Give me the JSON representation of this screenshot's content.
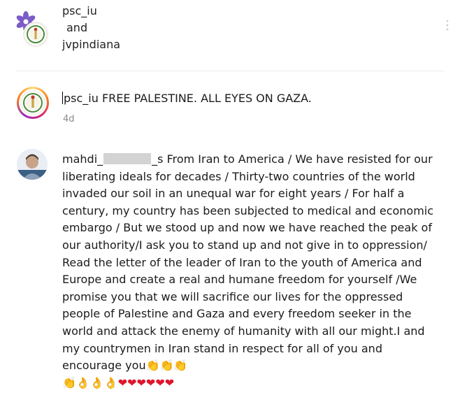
{
  "post_header": {
    "author_primary": "psc_iu",
    "conjunction": "and",
    "author_secondary": "jvpindiana"
  },
  "caption": {
    "username": "psc_iu",
    "text": "FREE PALESTINE. ALL EYES ON GAZA.",
    "time_ago": "4d"
  },
  "comment": {
    "username_start": "mahdi_",
    "username_end": "_s",
    "text": "From Iran to America / We have resisted for our liberating ideals for decades / Thirty-two countries of the world invaded our soil in an unequal war for eight years / For half a century, my country has been subjected to medical and economic embargo / But we stood up and now we have reached the peak of our authority/I ask you to stand up and not give in to oppression/ Read the letter of the leader of Iran to the youth of America and Europe and create a real and humane freedom for yourself /We promise you that we will sacrifice our lives for the oppressed people of Palestine and Gaza and every freedom seeker in the world and attack the enemy of humanity with all our might.I and my countrymen in Iran stand in respect for all of you and encourage you",
    "emoji_tail": "👏👏👏",
    "emoji_line": "👏👌👌👌❤❤❤❤❤❤"
  },
  "icons": {
    "more": "more-vertical-icon",
    "accent_ring_start": "#feda75",
    "accent_ring_end": "#962fbf"
  }
}
